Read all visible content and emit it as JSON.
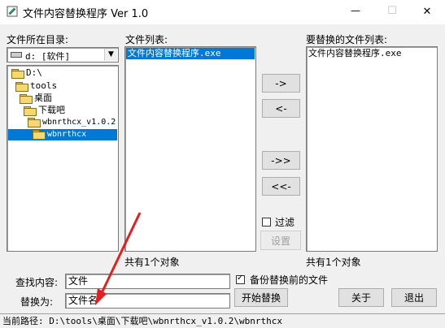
{
  "window": {
    "title": "文件内容替换程序 Ver 1.0",
    "minimize": "—",
    "maximize": "☐",
    "close": "✕"
  },
  "labels": {
    "dir_label": "文件所在目录:",
    "file_list_label": "文件列表:",
    "replace_list_label": "要替换的文件列表:",
    "find_label": "查找内容:",
    "replace_label": "替换为:"
  },
  "drive_select": {
    "value": "d: [软件]"
  },
  "tree": [
    {
      "label": "D:\\"
    },
    {
      "label": "tools"
    },
    {
      "label": "桌面"
    },
    {
      "label": "下载吧"
    },
    {
      "label": "wbnrthcx_v1.0.2"
    },
    {
      "label": "wbnrthcx"
    }
  ],
  "file_list": {
    "items": [
      "文件内容替换程序.exe"
    ],
    "count": "共有1个对象"
  },
  "replace_list": {
    "items": [
      "文件内容替换程序.exe"
    ],
    "count": "共有1个对象"
  },
  "buttons": {
    "add_one": "->",
    "remove_one": "<-",
    "add_all": "->>",
    "remove_all": "<<-",
    "settings": "设置",
    "start": "开始替换",
    "about": "关于",
    "exit": "退出"
  },
  "filter": {
    "label": "过滤",
    "checked": false
  },
  "backup": {
    "label": "备份替换前的文件",
    "checked": true
  },
  "inputs": {
    "find_value": "文件",
    "replace_value": "文件名"
  },
  "status": {
    "path": "当前路径: D:\\tools\\桌面\\下载吧\\wbnrthcx_v1.0.2\\wbnrthcx"
  },
  "colors": {
    "selection": "#0078d7",
    "annotation_arrow": "#e02020"
  }
}
